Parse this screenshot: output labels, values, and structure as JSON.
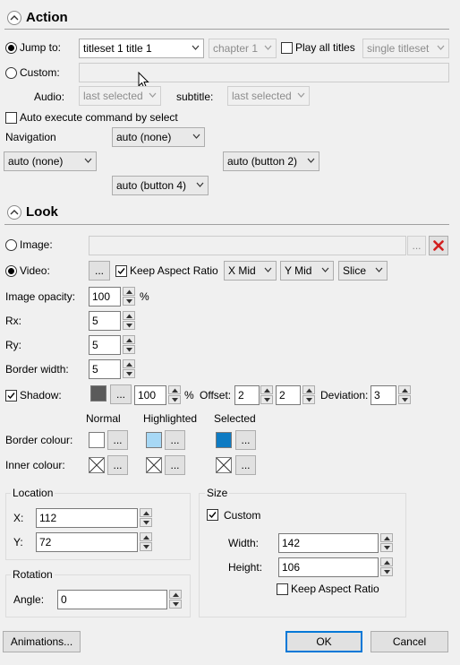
{
  "action": {
    "title": "Action",
    "jump_to": {
      "label": "Jump to:",
      "selected": true,
      "target": "titleset 1 title 1",
      "chapter": "chapter 1",
      "play_all_label": "Play all titles",
      "play_all_checked": false,
      "scope": "single titleset"
    },
    "custom": {
      "label": "Custom:",
      "selected": false,
      "value": ""
    },
    "audio": {
      "label": "Audio:",
      "value": "last selected"
    },
    "subtitle": {
      "label": "subtitle:",
      "value": "last selected"
    },
    "auto_execute": {
      "label": "Auto execute command by select",
      "checked": false
    },
    "navigation": {
      "label": "Navigation",
      "up": "auto (none)",
      "left": "auto (none)",
      "right": "auto (button 2)",
      "down": "auto (button 4)"
    }
  },
  "look": {
    "title": "Look",
    "image": {
      "label": "Image:",
      "selected": false,
      "value": "",
      "browse": "..."
    },
    "video": {
      "label": "Video:",
      "selected": true,
      "browse": "...",
      "keep_aspect_label": "Keep Aspect Ratio",
      "keep_aspect_checked": true,
      "x_align": "X Mid",
      "y_align": "Y Mid",
      "fit": "Slice"
    },
    "image_opacity": {
      "label": "Image opacity:",
      "value": "100",
      "unit": "%"
    },
    "rx": {
      "label": "Rx:",
      "value": "5"
    },
    "ry": {
      "label": "Ry:",
      "value": "5"
    },
    "border_width": {
      "label": "Border width:",
      "value": "5"
    },
    "shadow": {
      "label": "Shadow:",
      "checked": true,
      "color": "#5a5a5a",
      "browse": "...",
      "opacity": "100",
      "unit": "%",
      "offset_label": "Offset:",
      "offset_x": "2",
      "offset_y": "2",
      "deviation_label": "Deviation:",
      "deviation": "3"
    },
    "states": {
      "normal": "Normal",
      "highlighted": "Highlighted",
      "selected": "Selected"
    },
    "border_colour": {
      "label": "Border colour:",
      "normal": "#ffffff",
      "highlighted": "#a7d8f5",
      "selected": "#0e7bc3",
      "browse": "..."
    },
    "inner_colour": {
      "label": "Inner colour:",
      "browse": "..."
    }
  },
  "location": {
    "title": "Location",
    "x_label": "X:",
    "x": "112",
    "y_label": "Y:",
    "y": "72"
  },
  "size": {
    "title": "Size",
    "custom_label": "Custom",
    "custom_checked": true,
    "width_label": "Width:",
    "width": "142",
    "height_label": "Height:",
    "height": "106",
    "keep_aspect_label": "Keep Aspect Ratio",
    "keep_aspect_checked": false
  },
  "rotation": {
    "title": "Rotation",
    "angle_label": "Angle:",
    "angle": "0"
  },
  "footer": {
    "animations": "Animations...",
    "ok": "OK",
    "cancel": "Cancel"
  },
  "colors": {
    "accent": "#0078d7",
    "delete_red": "#d21f1f"
  }
}
